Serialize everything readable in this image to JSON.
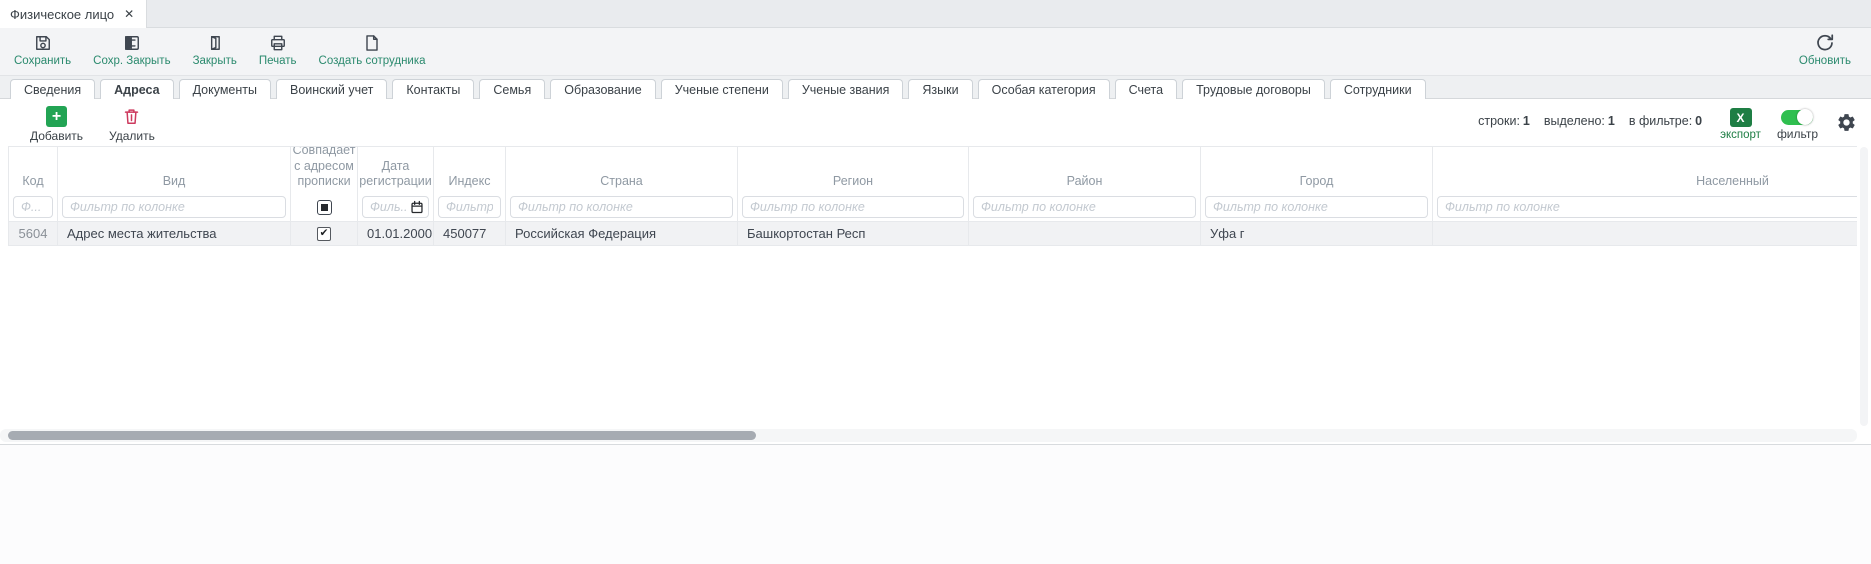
{
  "titlebar": {
    "tab_title": "Физическое лицо",
    "close_glyph": "✕"
  },
  "toolbar": {
    "buttons": [
      {
        "label": "Сохранить"
      },
      {
        "label": "Сохр. Закрыть"
      },
      {
        "label": "Закрыть"
      },
      {
        "label": "Печать"
      },
      {
        "label": "Создать сотрудника"
      }
    ],
    "refresh_label": "Обновить"
  },
  "tabs": {
    "active": "Адреса",
    "items": [
      {
        "label": "Сведения"
      },
      {
        "label": "Адреса"
      },
      {
        "label": "Документы"
      },
      {
        "label": "Воинский учет"
      },
      {
        "label": "Контакты"
      },
      {
        "label": "Семья"
      },
      {
        "label": "Образование"
      },
      {
        "label": "Ученые степени"
      },
      {
        "label": "Ученые звания"
      },
      {
        "label": "Языки"
      },
      {
        "label": "Особая категория"
      },
      {
        "label": "Счета"
      },
      {
        "label": "Трудовые договоры"
      },
      {
        "label": "Сотрудники"
      }
    ]
  },
  "grid_toolbar": {
    "add_label": "Добавить",
    "add_glyph": "+",
    "delete_label": "Удалить",
    "stats": {
      "rows_label": "строки:",
      "rows_value": "1",
      "selected_label": "выделено:",
      "selected_value": "1",
      "filtered_label": "в фильтре:",
      "filtered_value": "0"
    },
    "export": {
      "label": "экспорт",
      "glyph": "X"
    },
    "filter_toggle": {
      "label": "фильтр",
      "state": "on"
    }
  },
  "table": {
    "columns": [
      {
        "label": "Код",
        "filter": "Ф..."
      },
      {
        "label": "Вид",
        "filter": "Фильтр по колонке"
      },
      {
        "label": "Совпадает с адресом прописки"
      },
      {
        "label": "Дата регистрации",
        "filter": "Филь..."
      },
      {
        "label": "Индекс",
        "filter": "Фильтр..."
      },
      {
        "label": "Страна",
        "filter": "Фильтр по колонке"
      },
      {
        "label": "Регион",
        "filter": "Фильтр по колонке"
      },
      {
        "label": "Район",
        "filter": "Фильтр по колонке"
      },
      {
        "label": "Город",
        "filter": "Фильтр по колонке"
      },
      {
        "label": "Населенный",
        "filter": "Фильтр по колонке"
      }
    ],
    "check_glyph": "✔",
    "row": {
      "code": "5604",
      "kind": "Адрес места жительства",
      "matches_checked": true,
      "date": "01.01.2000",
      "index": "450077",
      "country": "Российская Федерация",
      "region": "Башкортостан Респ",
      "district": "",
      "city": "Уфа г",
      "settlement": ""
    }
  },
  "colors": {
    "accent_teal": "#2b8a6e",
    "add_green": "#22a454",
    "delete_red": "#cd3a5e",
    "export_green": "#1e7e44",
    "toggle_green": "#2fbf4f"
  }
}
